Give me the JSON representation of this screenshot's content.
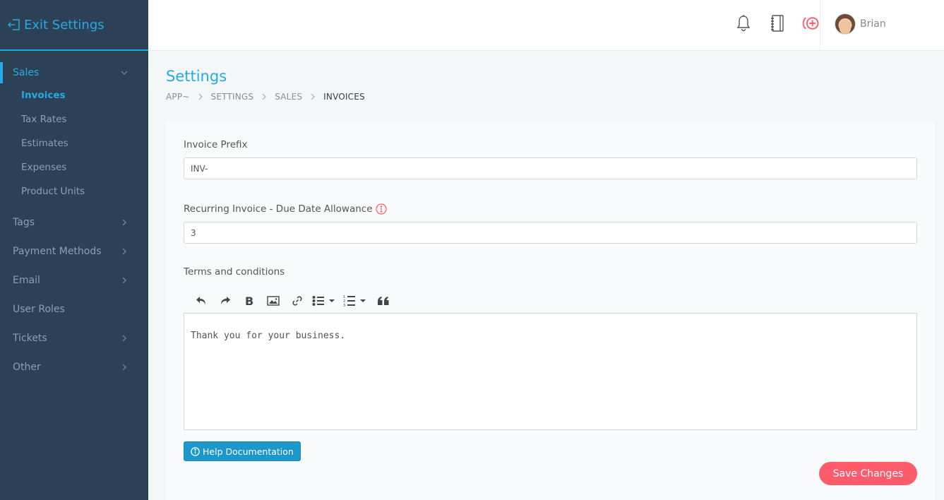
{
  "sidebar": {
    "exit_label": "Exit Settings",
    "groups": [
      {
        "label": "Sales",
        "expanded": true,
        "active": true,
        "items": [
          {
            "label": "Invoices",
            "active": true
          },
          {
            "label": "Tax Rates"
          },
          {
            "label": "Estimates"
          },
          {
            "label": "Expenses"
          },
          {
            "label": "Product Units"
          }
        ]
      },
      {
        "label": "Tags",
        "has_children": true
      },
      {
        "label": "Payment Methods",
        "has_children": true
      },
      {
        "label": "Email",
        "has_children": true
      },
      {
        "label": "User Roles",
        "has_children": false
      },
      {
        "label": "Tickets",
        "has_children": true
      },
      {
        "label": "Other",
        "has_children": true
      }
    ]
  },
  "topbar": {
    "icons": [
      "bell-icon",
      "notebook-icon",
      "add-circle-icon"
    ],
    "user_name": "Brian",
    "accent": "#fe5c6a"
  },
  "page": {
    "title": "Settings",
    "breadcrumb": [
      "APP~",
      "SETTINGS",
      "SALES",
      "INVOICES"
    ]
  },
  "form": {
    "invoice_prefix_label": "Invoice Prefix",
    "invoice_prefix_value": "INV-",
    "due_date_label": "Recurring Invoice - Due Date Allowance",
    "due_date_value": "3",
    "terms_label": "Terms and conditions",
    "terms_value": "Thank you for your business.",
    "toolbar": [
      "undo",
      "redo",
      "bold",
      "image",
      "link",
      "bullet-list",
      "numbered-list",
      "blockquote"
    ],
    "help_label": "Help Documentation",
    "save_label": "Save Changes"
  },
  "colors": {
    "primary": "#27a9e1",
    "sidebar_bg": "#2c4156",
    "save": "#fe5c6a",
    "help": "#1b97c9"
  }
}
